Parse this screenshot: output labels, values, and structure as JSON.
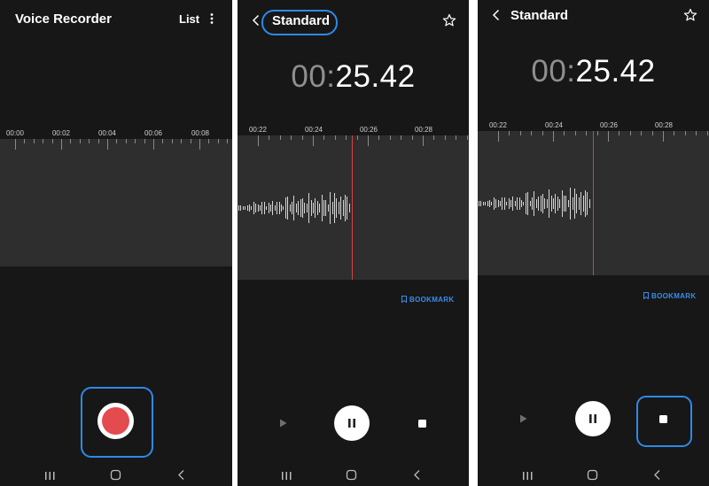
{
  "colors": {
    "accent_blue": "#2d8ae8",
    "record_red": "#e44b4f",
    "playhead_red": "#d9413a",
    "bg": "#171717",
    "wave_bg": "#2e2e2e"
  },
  "screen1": {
    "title": "Voice Recorder",
    "list_label": "List",
    "menu_icon": "more-vert-icon",
    "timeline_ticks": [
      "00:00",
      "00:02",
      "00:04",
      "00:06",
      "00:08"
    ]
  },
  "screen2": {
    "title": "Standard",
    "back_icon": "chevron-left-icon",
    "star_icon": "star-outline-icon",
    "timer_minutes": "00",
    "timer_sep": ":",
    "timer_seconds": "25.42",
    "timeline_ticks": [
      "00:22",
      "00:24",
      "00:26",
      "00:28"
    ],
    "bookmark_label": "BOOKMARK"
  },
  "screen3": {
    "title": "Standard",
    "back_icon": "chevron-left-icon",
    "star_icon": "star-outline-icon",
    "timer_minutes": "00",
    "timer_sep": ":",
    "timer_seconds": "25.42",
    "timeline_ticks": [
      "00:22",
      "00:24",
      "00:26",
      "00:28"
    ],
    "bookmark_label": "BOOKMARK"
  },
  "nav_icons": [
    "recent-apps-icon",
    "home-icon",
    "back-icon"
  ]
}
